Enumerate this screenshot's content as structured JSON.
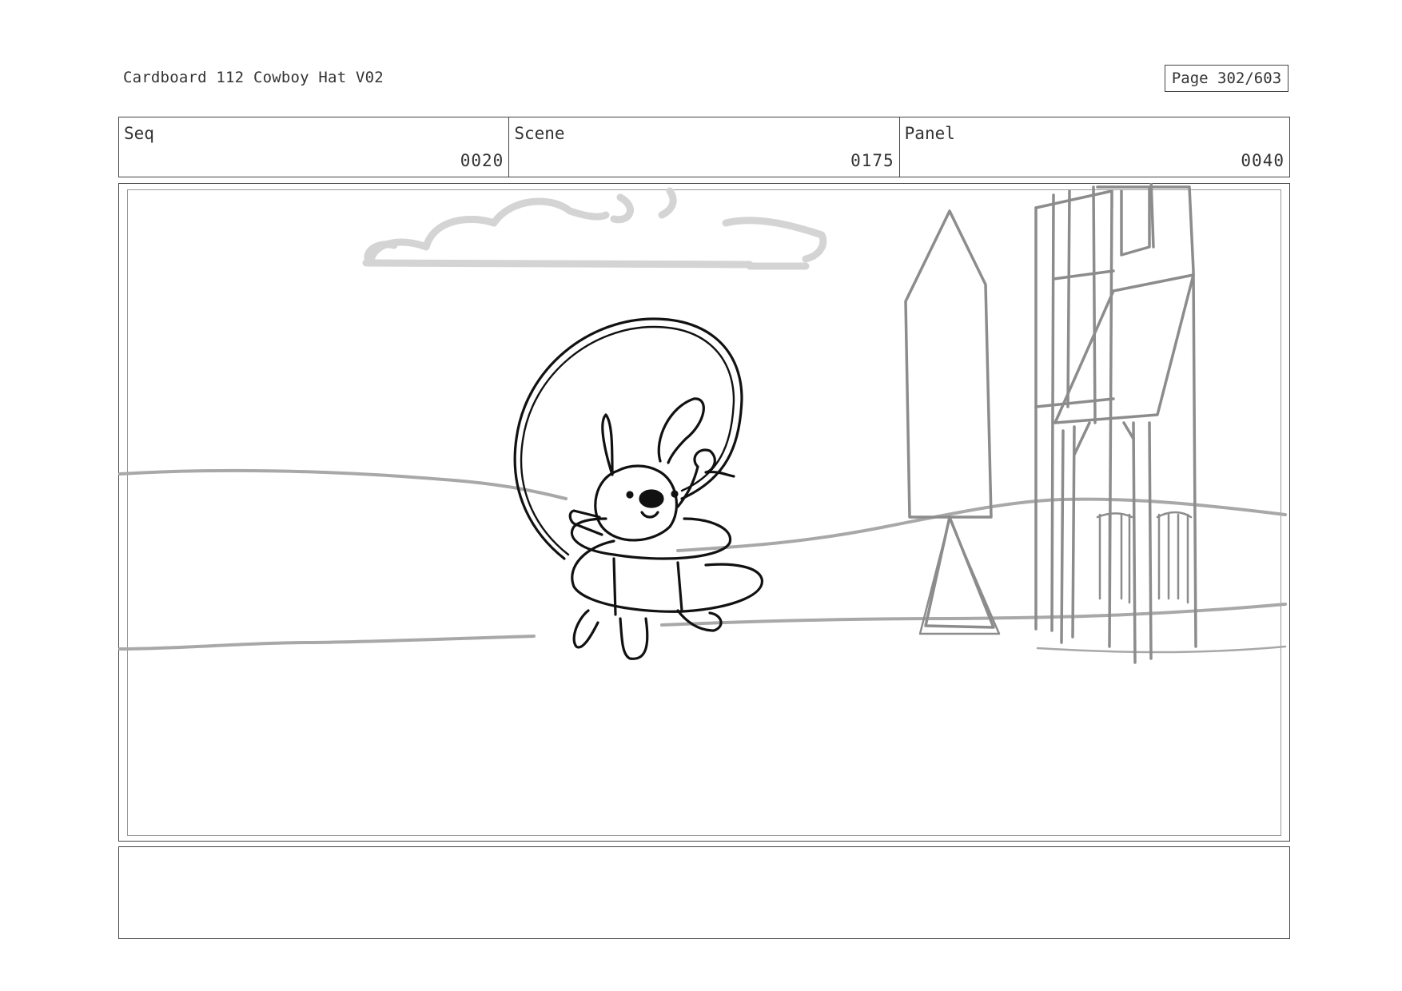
{
  "header": {
    "title": "Cardboard 112 Cowboy Hat V02",
    "page": "Page 302/603"
  },
  "meta": {
    "seq_label": "Seq",
    "seq_value": "0020",
    "scene_label": "Scene",
    "scene_value": "0175",
    "panel_label": "Panel",
    "panel_value": "0040"
  },
  "notes": {
    "text": ""
  }
}
